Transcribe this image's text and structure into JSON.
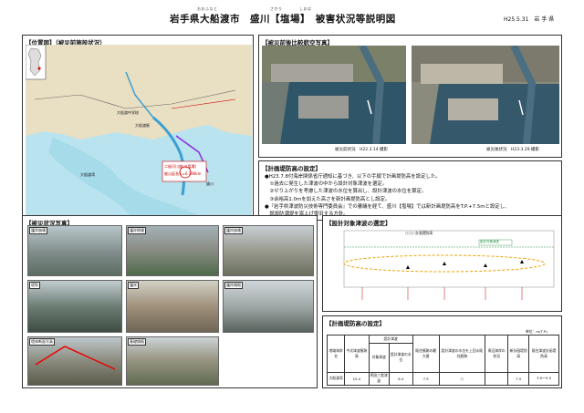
{
  "header": {
    "title": "岩手県大船渡市　盛川【塩場】　被害状況等説明図",
    "ruby_ofunato": "おおふなと",
    "ruby_sakari": "さかり",
    "ruby_shiba": "しおば",
    "date": "H25.5.31　岩 手 県"
  },
  "location": {
    "title": "【位置図】（被災前施設状況）",
    "map_labels": {
      "ofunato": "大船渡",
      "kamaishi": "釜石",
      "sakari": "盛川",
      "school": "大船渡中学校",
      "station": "大船渡駅",
      "target": "二級河川盛川(塩場)",
      "length": "被災延長 L=0.346km",
      "bay": "大船渡湾"
    }
  },
  "aerial": {
    "title": "【被災前後比較航空写真】",
    "before_caption": "被災前状況　H22.3.14 撮影",
    "after_caption": "被災後状況　H23.3.29 撮影"
  },
  "design": {
    "title": "【計画堤防高の設定】",
    "lines": [
      "●H23.7.8付海岸関係省庁通知に基づき、以下の手順で計画堤防高を設定した。",
      "　①過去に発生した津波の中から設計対象津波を選定。",
      "　②せり上がりを考慮した津波の水位を算出し、設計津波の水位を算定。",
      "　③余裕高1.0mを加えた高さを新計画堤防高とし設定。",
      "●『岩手県津波防災技術専門委員会』での審議を経て、盛川【塩場】では新計画堤防高をT.P.+7.5mと設定し、",
      "　既設防潮堤を嵩上げ復旧する方針。"
    ]
  },
  "damage": {
    "title": "【被災状況写真】",
    "tags": [
      "護岸崩壊",
      "護岸倒壊",
      "護岸崩壊",
      "堤防",
      "護岸",
      "護岸損傷",
      "堤体断面写真",
      "基礎損傷"
    ]
  },
  "tsunami": {
    "title": "【設計対象津波の選定】",
    "legend": "○○○ 計画堤防高",
    "design_label": "設計対象津波"
  },
  "table_section": {
    "title": "【計画堤防高の設定】",
    "unit": "単位：m(T.P.)",
    "headers": [
      "地域海岸名",
      "今次津波痕跡高",
      "設計津波",
      "対象津波",
      "設計津波の水位",
      "既往痕跡の最大値",
      "設計津波の水位を上回る既往痕跡",
      "周辺海岸の状況",
      "新計画堤防高",
      "既往津波計画堤防高"
    ],
    "row": [
      "大船渡湾",
      "10.4",
      "明治三陸津波",
      "6.4",
      "7.5",
      "○",
      "7.5",
      "3.0〜5.5"
    ]
  }
}
